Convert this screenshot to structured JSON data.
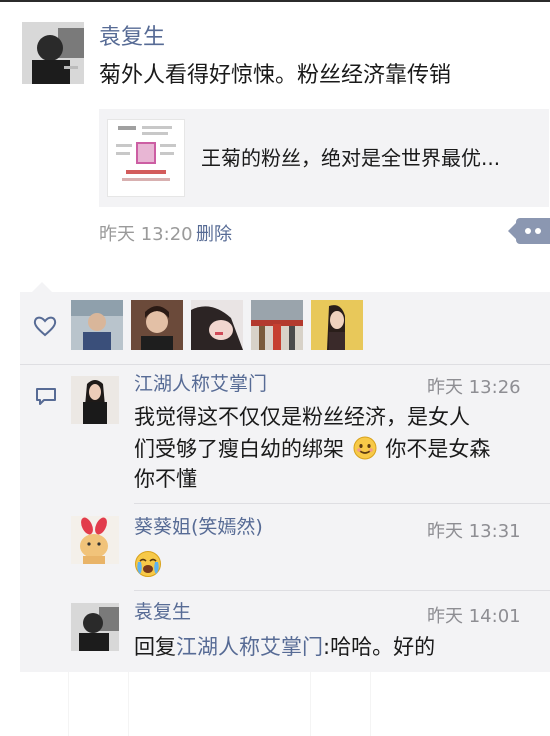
{
  "post": {
    "author": "袁复生",
    "text": "菊外人看得好惊悚。粉丝经济靠传销",
    "share_title": "王菊的粉丝，绝对是全世界最优...",
    "time": "昨天 13:20",
    "delete_label": "删除"
  },
  "comments": [
    {
      "author": "江湖人称艾掌门",
      "time": "昨天 13:26",
      "lines": [
        "我觉得这不仅仅是粉丝经济，是女人",
        "们受够了瘦白幼的绑架",
        "你不是女森",
        "你不懂"
      ]
    },
    {
      "author": "葵葵姐(笑嫣然)",
      "time": "昨天 13:31"
    },
    {
      "author": "袁复生",
      "time": "昨天 14:01",
      "reply_prefix": "回复",
      "reply_to": "江湖人称艾掌门",
      "reply_text": ":哈哈。好的"
    }
  ],
  "icons": {
    "like": "heart-outline-icon",
    "comment": "comment-bubble-icon",
    "more": "more-dots-icon",
    "smile": "smile-emoji-icon",
    "cry": "crying-emoji-icon"
  },
  "colors": {
    "link": "#576b95",
    "panel": "#f3f3f5",
    "muted": "#9a9a9a"
  }
}
